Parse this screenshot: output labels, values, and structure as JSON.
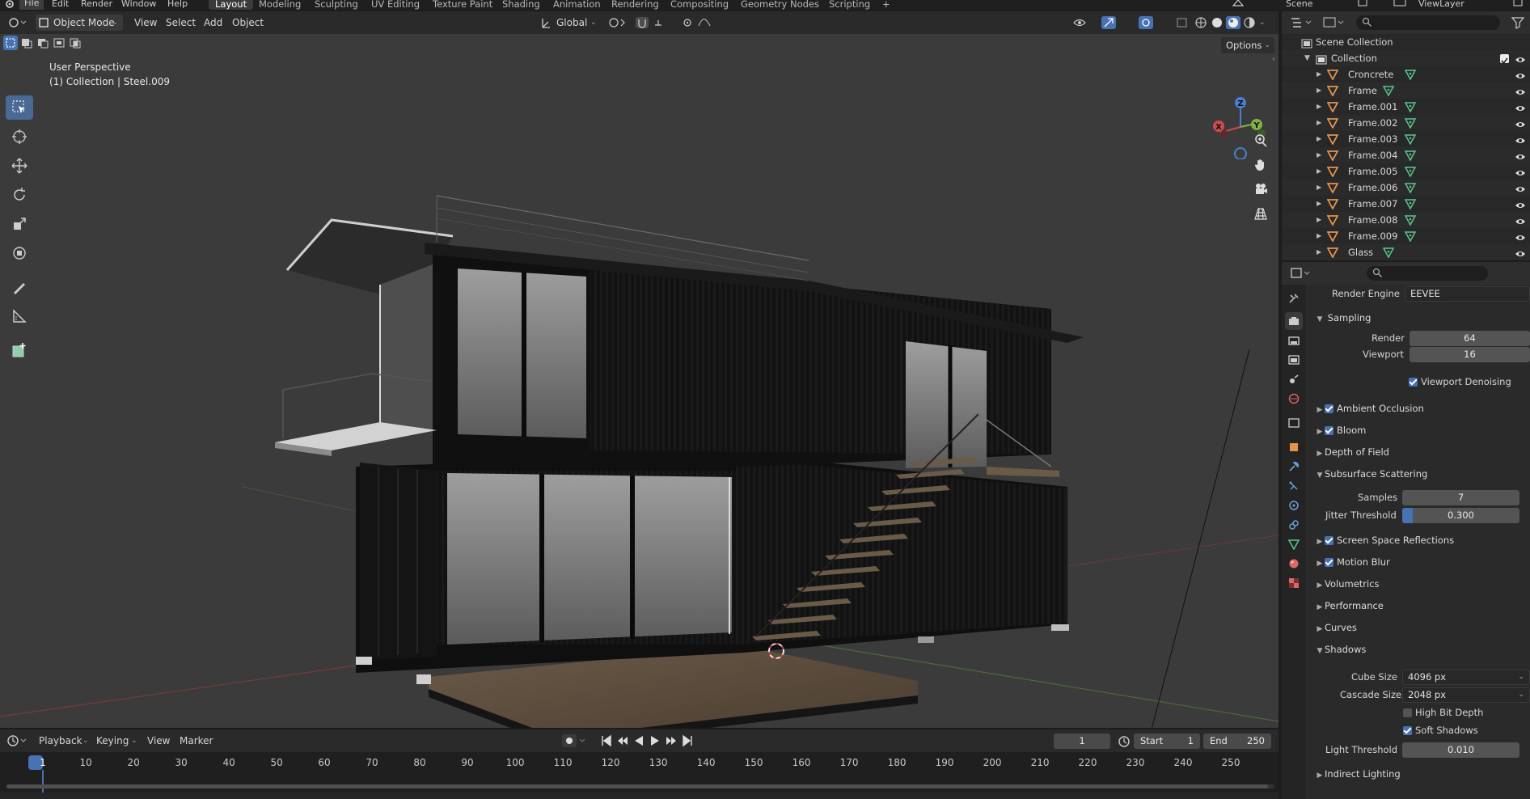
{
  "menubar": {
    "items": [
      "File",
      "Edit",
      "Render",
      "Window",
      "Help"
    ],
    "workspaces": [
      "Layout",
      "Modeling",
      "Sculpting",
      "UV Editing",
      "Texture Paint",
      "Shading",
      "Animation",
      "Rendering",
      "Compositing",
      "Geometry Nodes",
      "Scripting"
    ],
    "active_workspace": "Layout",
    "add_tab": "+",
    "scene": "Scene",
    "view_layer": "ViewLayer"
  },
  "viewport_header": {
    "mode": "Object Mode",
    "menus": [
      "View",
      "Select",
      "Add",
      "Object"
    ],
    "orientation": "Global",
    "options": "Options"
  },
  "viewport": {
    "perspective": "User Perspective",
    "collection_info": "(1) Collection | Steel.009",
    "gizmo_axes": {
      "x": "X",
      "y": "Y",
      "z": "Z"
    }
  },
  "outliner": {
    "root": "Scene Collection",
    "collection": "Collection",
    "objects": [
      "Croncrete",
      "Frame",
      "Frame.001",
      "Frame.002",
      "Frame.003",
      "Frame.004",
      "Frame.005",
      "Frame.006",
      "Frame.007",
      "Frame.008",
      "Frame.009",
      "Glass"
    ]
  },
  "properties": {
    "render_engine_label": "Render Engine",
    "render_engine": "EEVEE",
    "sampling": {
      "title": "Sampling",
      "render_label": "Render",
      "render_value": "64",
      "viewport_label": "Viewport",
      "viewport_value": "16",
      "denoise_label": "Viewport Denoising"
    },
    "sections_a": [
      "Ambient Occlusion",
      "Bloom"
    ],
    "depth_of_field": "Depth of Field",
    "sss": {
      "title": "Subsurface Scattering",
      "samples_label": "Samples",
      "samples_value": "7",
      "jitter_label": "Jitter Threshold",
      "jitter_value": "0.300",
      "jitter_fraction": 0.3
    },
    "sections_b": [
      "Screen Space Reflections",
      "Motion Blur"
    ],
    "sections_c": [
      "Volumetrics",
      "Performance",
      "Curves"
    ],
    "shadows": {
      "title": "Shadows",
      "cube_label": "Cube Size",
      "cube_value": "4096 px",
      "cascade_label": "Cascade Size",
      "cascade_value": "2048 px",
      "high_bit_label": "High Bit Depth",
      "soft_label": "Soft Shadows",
      "light_thresh_label": "Light Threshold",
      "light_thresh_value": "0.010"
    },
    "indirect": "Indirect Lighting"
  },
  "timeline": {
    "menus": [
      "Playback",
      "Keying",
      "View",
      "Marker"
    ],
    "current_frame": "1",
    "start_label": "Start",
    "start_value": "1",
    "end_label": "End",
    "end_value": "250",
    "ticks": [
      "1",
      "10",
      "20",
      "30",
      "40",
      "50",
      "60",
      "70",
      "80",
      "90",
      "100",
      "110",
      "120",
      "130",
      "140",
      "150",
      "160",
      "170",
      "180",
      "190",
      "200",
      "210",
      "220",
      "230",
      "240",
      "250"
    ]
  },
  "colors": {
    "accent": "#4772b3",
    "active_tool": "#4a6a95",
    "object_icon": "#e5924a",
    "mesh_icon": "#59c98a"
  }
}
